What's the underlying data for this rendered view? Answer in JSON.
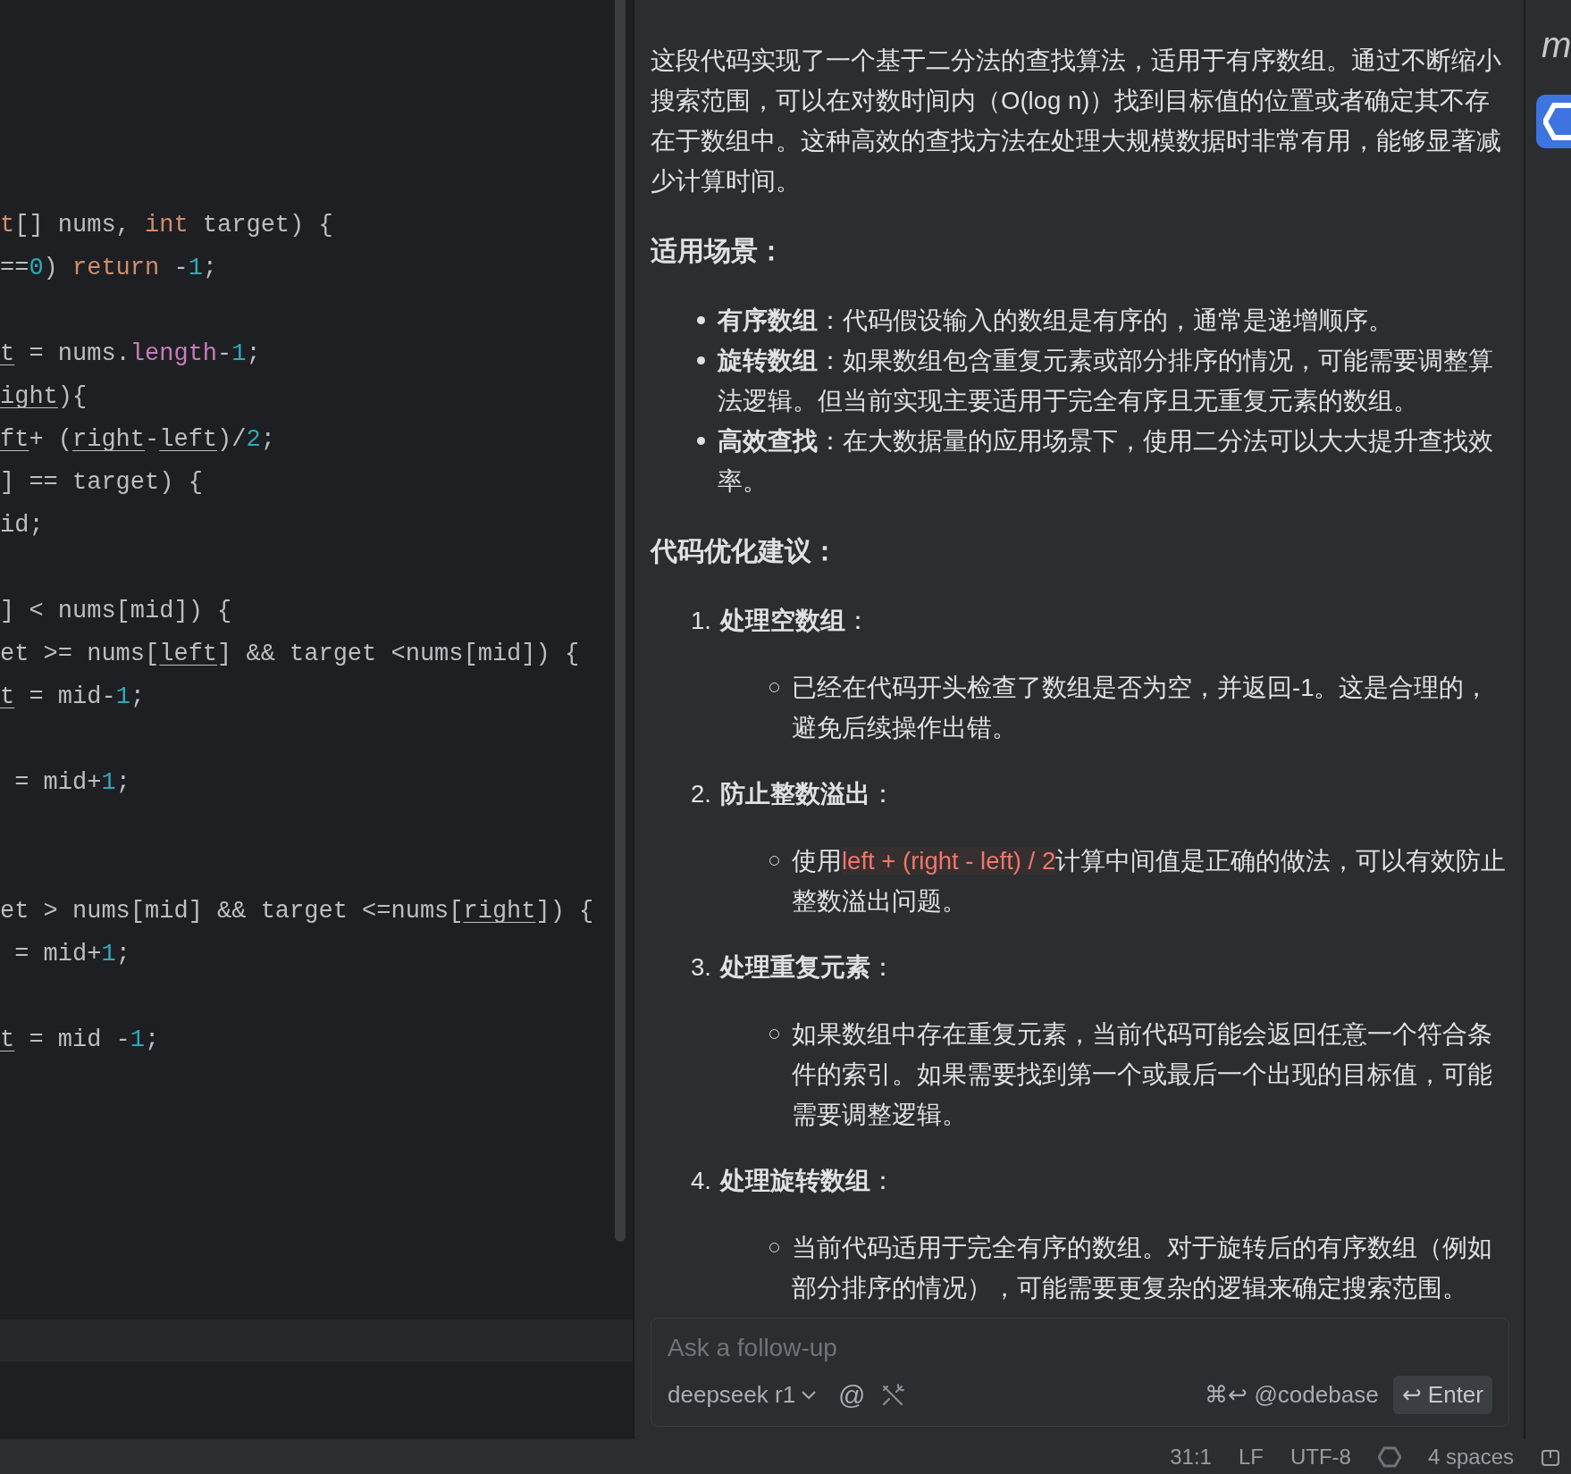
{
  "editor": {
    "lines": [
      {
        "tokens": [
          {
            "text": "t",
            "kind": "keyword"
          },
          {
            "text": "[] nums, ",
            "kind": "plain"
          },
          {
            "text": "int",
            "kind": "keyword"
          },
          {
            "text": " target) {",
            "kind": "plain"
          }
        ]
      },
      {
        "tokens": [
          {
            "text": "==",
            "kind": "plain"
          },
          {
            "text": "0",
            "kind": "number"
          },
          {
            "text": ") ",
            "kind": "plain"
          },
          {
            "text": "return",
            "kind": "keyword"
          },
          {
            "text": " -",
            "kind": "plain"
          },
          {
            "text": "1",
            "kind": "number"
          },
          {
            "text": ";",
            "kind": "plain"
          }
        ]
      },
      {
        "kind": "blank"
      },
      {
        "tokens": [
          {
            "text": "t",
            "kind": "variable"
          },
          {
            "text": " = nums.",
            "kind": "plain"
          },
          {
            "text": "length",
            "kind": "field"
          },
          {
            "text": "-",
            "kind": "plain"
          },
          {
            "text": "1",
            "kind": "number"
          },
          {
            "text": ";",
            "kind": "plain"
          }
        ]
      },
      {
        "tokens": [
          {
            "text": "ight",
            "kind": "variable"
          },
          {
            "text": "){",
            "kind": "plain"
          }
        ]
      },
      {
        "tokens": [
          {
            "text": "ft",
            "kind": "variable"
          },
          {
            "text": "+ (",
            "kind": "plain"
          },
          {
            "text": "right",
            "kind": "variable"
          },
          {
            "text": "-",
            "kind": "plain"
          },
          {
            "text": "left",
            "kind": "variable"
          },
          {
            "text": ")/",
            "kind": "plain"
          },
          {
            "text": "2",
            "kind": "number"
          },
          {
            "text": ";",
            "kind": "plain"
          }
        ]
      },
      {
        "tokens": [
          {
            "text": "] == target) {",
            "kind": "plain"
          }
        ]
      },
      {
        "tokens": [
          {
            "text": "id;",
            "kind": "plain"
          }
        ]
      },
      {
        "kind": "blank"
      },
      {
        "tokens": [
          {
            "text": "] < nums[mid]) {",
            "kind": "plain"
          }
        ]
      },
      {
        "tokens": [
          {
            "text": "et >= nums[",
            "kind": "plain"
          },
          {
            "text": "left",
            "kind": "variable"
          },
          {
            "text": "] && target <nums[mid]) {",
            "kind": "plain"
          }
        ]
      },
      {
        "tokens": [
          {
            "text": "t",
            "kind": "variable"
          },
          {
            "text": " = mid-",
            "kind": "plain"
          },
          {
            "text": "1",
            "kind": "number"
          },
          {
            "text": ";",
            "kind": "plain"
          }
        ]
      },
      {
        "kind": "blank"
      },
      {
        "tokens": [
          {
            "text": " = mid+",
            "kind": "plain"
          },
          {
            "text": "1",
            "kind": "number"
          },
          {
            "text": ";",
            "kind": "plain"
          }
        ]
      },
      {
        "kind": "blank"
      },
      {
        "kind": "blank"
      },
      {
        "tokens": [
          {
            "text": "et > nums[mid] && target <=nums[",
            "kind": "plain"
          },
          {
            "text": "right",
            "kind": "variable"
          },
          {
            "text": "]) {",
            "kind": "plain"
          }
        ]
      },
      {
        "tokens": [
          {
            "text": " = mid+",
            "kind": "plain"
          },
          {
            "text": "1",
            "kind": "number"
          },
          {
            "text": ";",
            "kind": "plain"
          }
        ]
      },
      {
        "kind": "blank"
      },
      {
        "tokens": [
          {
            "text": "t",
            "kind": "variable"
          },
          {
            "text": " = mid -",
            "kind": "plain"
          },
          {
            "text": "1",
            "kind": "number"
          },
          {
            "text": ";",
            "kind": "plain"
          }
        ]
      }
    ]
  },
  "chat": {
    "intro": "这段代码实现了一个基于二分法的查找算法，适用于有序数组。通过不断缩小搜索范围，可以在对数时间内（O(log n)）找到目标值的位置或者确定其不存在于数组中。这种高效的查找方法在处理大规模数据时非常有用，能够显著减少计算时间。",
    "scenarios_heading": "适用场景：",
    "scenarios": [
      "**有序数组**：代码假设输入的数组是有序的，通常是递增顺序。",
      "**旋转数组**：如果数组包含重复元素或部分排序的情况，可能需要调整算法逻辑。但当前实现主要适用于完全有序且无重复元素的数组。",
      "**高效查找**：在大数据量的应用场景下，使用二分法可以大大提升查找效率。"
    ],
    "suggestions_heading": "代码优化建议：",
    "suggestions": [
      {
        "number": "1.",
        "title": "**处理空数组**：",
        "points": [
          [
            {
              "kind": "text",
              "text": "已经在代码开头检查了数组是否为空，并返回-1。这是合理的，避免后续操作出错。"
            }
          ]
        ]
      },
      {
        "number": "2.",
        "title": "**防止整数溢出**：",
        "points": [
          [
            {
              "kind": "text",
              "text": "使用"
            },
            {
              "kind": "code",
              "text": "left + (right - left) / 2"
            },
            {
              "kind": "text",
              "text": "计算中间值是正确的做法，可以有效防止整数溢出问题。"
            }
          ]
        ]
      },
      {
        "number": "3.",
        "title": "**处理重复元素**：",
        "points": [
          [
            {
              "kind": "text",
              "text": "如果数组中存在重复元素，当前代码可能会返回任意一个符合条件的索引。如果需要找到第一个或最后一个出现的目标值，可能需要调整逻辑。"
            }
          ]
        ]
      },
      {
        "number": "4.",
        "title": "**处理旋转数组**：",
        "points": [
          [
            {
              "kind": "text",
              "text": "当前代码适用于完全有序的数组。对于旋转后的有序数组（例如部分排序的情况），可能需要更复杂的逻辑来确定搜索范围。"
            }
          ]
        ]
      }
    ],
    "input": {
      "placeholder": "Ask a follow-up",
      "model": "deepseek r1",
      "mention": "@",
      "shortcut": "⌘↩ @codebase",
      "send": "↩ Enter"
    }
  },
  "side_strip": {
    "letter": "m"
  },
  "status_bar": {
    "position": "31:1",
    "line_ending": "LF",
    "encoding": "UTF-8",
    "indent": "4 spaces"
  }
}
